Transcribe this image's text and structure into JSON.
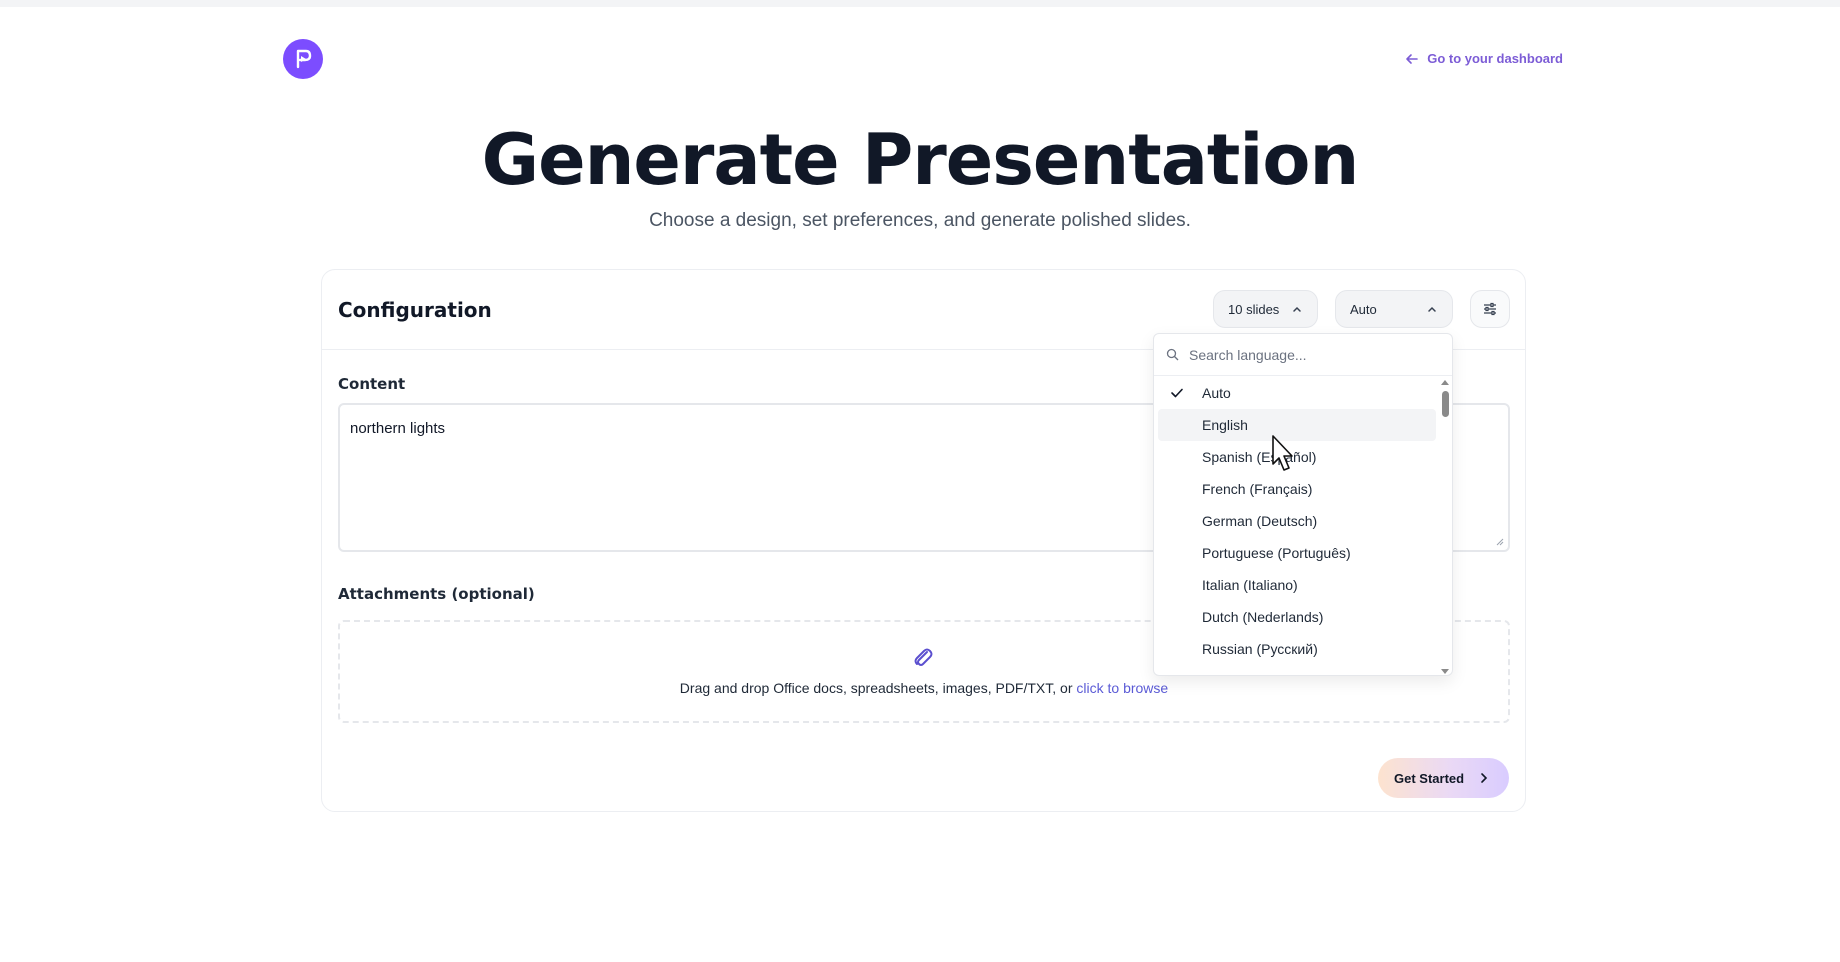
{
  "header": {
    "dashboard_link": "Go to your dashboard"
  },
  "hero": {
    "title": "Generate Presentation",
    "subtitle": "Choose a design, set preferences, and generate polished slides."
  },
  "config": {
    "title": "Configuration",
    "slides_label": "10 slides",
    "language_value": "Auto"
  },
  "content": {
    "label": "Content",
    "value": "northern lights"
  },
  "attachments": {
    "label": "Attachments (optional)",
    "text": "Drag and drop Office docs, spreadsheets, images, PDF/TXT, or ",
    "link": "click to browse"
  },
  "actions": {
    "get_started": "Get Started"
  },
  "language_dropdown": {
    "search_placeholder": "Search language...",
    "selected": "Auto",
    "hovered": "English",
    "options": [
      "Auto",
      "English",
      "Spanish (Español)",
      "French (Français)",
      "German (Deutsch)",
      "Portuguese (Português)",
      "Italian (Italiano)",
      "Dutch (Nederlands)",
      "Russian (Русский)"
    ]
  },
  "colors": {
    "brand": "#7c4dff",
    "link": "#7c5cd6",
    "browse_link": "#5b5bd6"
  },
  "icons": {
    "logo": "presentation-logo-icon",
    "back": "arrow-left-icon",
    "chevron": "chevron-up-icon",
    "settings": "sliders-icon",
    "search": "search-icon",
    "check": "check-icon",
    "attach": "paperclip-icon"
  }
}
